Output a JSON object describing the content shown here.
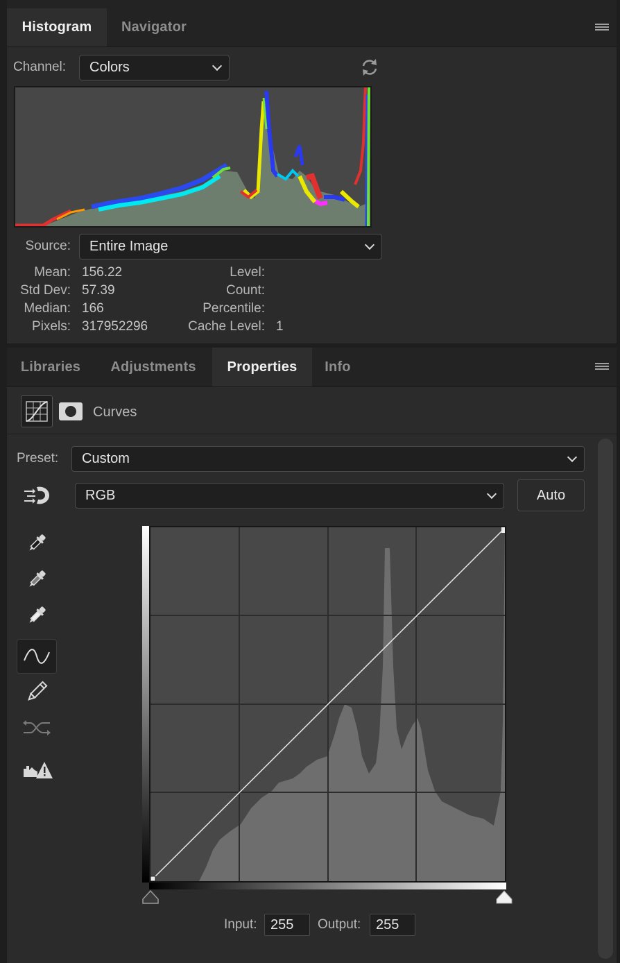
{
  "histogram_panel": {
    "tabs": [
      {
        "label": "Histogram",
        "active": true
      },
      {
        "label": "Navigator",
        "active": false
      }
    ],
    "channel_label": "Channel:",
    "channel_value": "Colors",
    "source_label": "Source:",
    "source_value": "Entire Image",
    "stats": {
      "mean_label": "Mean:",
      "mean": "156.22",
      "stddev_label": "Std Dev:",
      "stddev": "57.39",
      "median_label": "Median:",
      "median": "166",
      "pixels_label": "Pixels:",
      "pixels": "317952296",
      "level_label": "Level:",
      "level": "",
      "count_label": "Count:",
      "count": "",
      "percentile_label": "Percentile:",
      "percentile": "",
      "cache_label": "Cache Level:",
      "cache": "1"
    }
  },
  "properties_panel": {
    "tabs": [
      {
        "label": "Libraries",
        "active": false
      },
      {
        "label": "Adjustments",
        "active": false
      },
      {
        "label": "Properties",
        "active": true
      },
      {
        "label": "Info",
        "active": false
      }
    ],
    "title": "Curves",
    "preset_label": "Preset:",
    "preset_value": "Custom",
    "channel_value": "RGB",
    "auto_label": "Auto",
    "input_label": "Input:",
    "input_value": "255",
    "output_label": "Output:",
    "output_value": "255"
  },
  "icons": [
    "refresh-icon",
    "panel-menu-icon",
    "curves-adjustment-icon",
    "mask-icon",
    "on-image-adjust-icon",
    "black-point-eyedropper-icon",
    "gray-point-eyedropper-icon",
    "white-point-eyedropper-icon",
    "curve-point-tool-icon",
    "pencil-icon",
    "smooth-curve-icon",
    "clipping-warning-icon"
  ],
  "colors": {
    "panel_bg": "#2b2b2b",
    "tabbar_bg": "#232323",
    "field_bg": "#1f1f1f",
    "histogram_bg": "#474747",
    "histogram_fill": "#6f7f6f",
    "curves_bg": "#484848",
    "curves_hist": "#6e6e6e"
  }
}
